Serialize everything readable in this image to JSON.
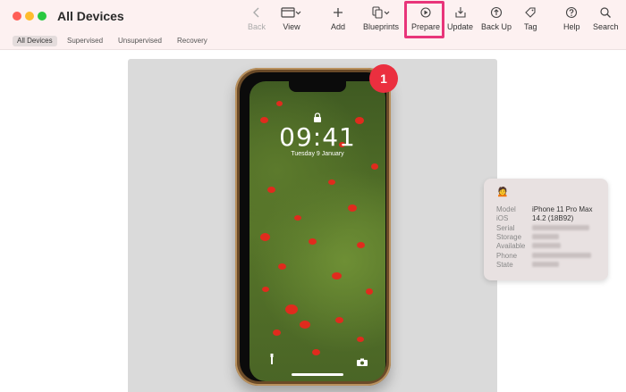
{
  "window": {
    "title": "All Devices"
  },
  "toolbar": {
    "back": {
      "label": "Back",
      "icon": "chevron-left-icon"
    },
    "view": {
      "label": "View",
      "icon": "window-icon"
    },
    "add": {
      "label": "Add",
      "icon": "plus-icon"
    },
    "blueprints": {
      "label": "Blueprints",
      "icon": "blueprints-icon"
    },
    "prepare": {
      "label": "Prepare",
      "icon": "prepare-icon"
    },
    "update": {
      "label": "Update",
      "icon": "update-icon"
    },
    "backup": {
      "label": "Back Up",
      "icon": "backup-icon"
    },
    "tag": {
      "label": "Tag",
      "icon": "tag-icon"
    },
    "help": {
      "label": "Help",
      "icon": "help-icon"
    },
    "search": {
      "label": "Search",
      "icon": "search-icon"
    }
  },
  "filters": [
    {
      "label": "All Devices",
      "active": true
    },
    {
      "label": "Supervised",
      "active": false
    },
    {
      "label": "Unsupervised",
      "active": false
    },
    {
      "label": "Recovery",
      "active": false
    }
  ],
  "device": {
    "badge_count": "1",
    "lock_screen": {
      "time": "09:41",
      "date": "Tuesday 9 January"
    }
  },
  "info": {
    "emoji": "🙍",
    "rows": [
      {
        "label": "Model",
        "value": "iPhone 11 Pro Max",
        "blurred": false
      },
      {
        "label": "iOS",
        "value": "14.2 (18B92)",
        "blurred": false
      },
      {
        "label": "Serial",
        "value": "",
        "blurred": true
      },
      {
        "label": "Storage",
        "value": "",
        "blurred": true
      },
      {
        "label": "Available",
        "value": "",
        "blurred": true
      },
      {
        "label": "Phone",
        "value": "",
        "blurred": true
      },
      {
        "label": "State",
        "value": "",
        "blurred": true
      }
    ]
  },
  "colors": {
    "highlight": "#e8357a",
    "badge": "#eb2f3f",
    "titlebar": "#fdf1f1"
  }
}
